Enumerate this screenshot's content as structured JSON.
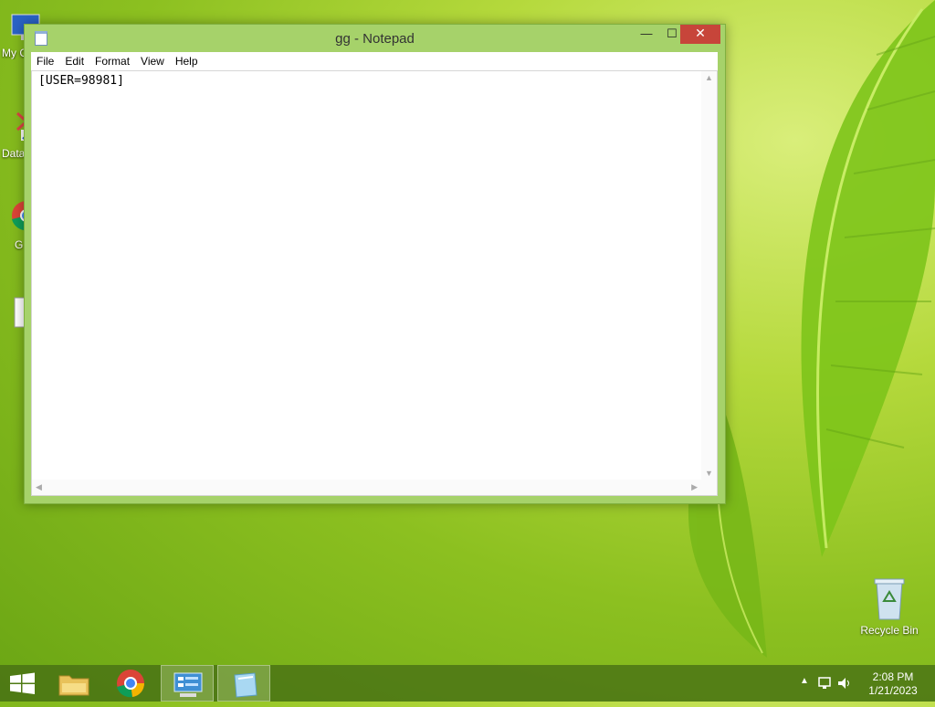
{
  "desktop": {
    "icons": [
      {
        "label": "My C",
        "icon": "computer-icon"
      },
      {
        "label": "Data",
        "icon": "shortcut-icon"
      },
      {
        "label": "G",
        "icon": "chrome-shortcut-icon"
      },
      {
        "label": "",
        "icon": "file-icon"
      }
    ],
    "recycle_bin": {
      "label": "Recycle Bin",
      "icon": "recycle-bin-icon"
    }
  },
  "window": {
    "title": "gg - Notepad",
    "controls": {
      "minimize": "—",
      "maximize": "☐",
      "close": "✕"
    },
    "menu": [
      "File",
      "Edit",
      "Format",
      "View",
      "Help"
    ],
    "content": "[USER=98981]"
  },
  "taskbar": {
    "start_icon": "windows-logo-icon",
    "items": [
      {
        "name": "file-explorer",
        "icon": "folder-icon",
        "active": false
      },
      {
        "name": "chrome",
        "icon": "chrome-icon",
        "active": false
      },
      {
        "name": "control-panel",
        "icon": "control-panel-icon",
        "active": true
      },
      {
        "name": "notepad",
        "icon": "notepad-icon",
        "active": true
      }
    ],
    "clock": {
      "time": "2:08 PM",
      "date": "1/21/2023"
    }
  },
  "colors": {
    "accent": "#a6d26a",
    "close": "#c7453a",
    "taskbar": "#466e14"
  }
}
